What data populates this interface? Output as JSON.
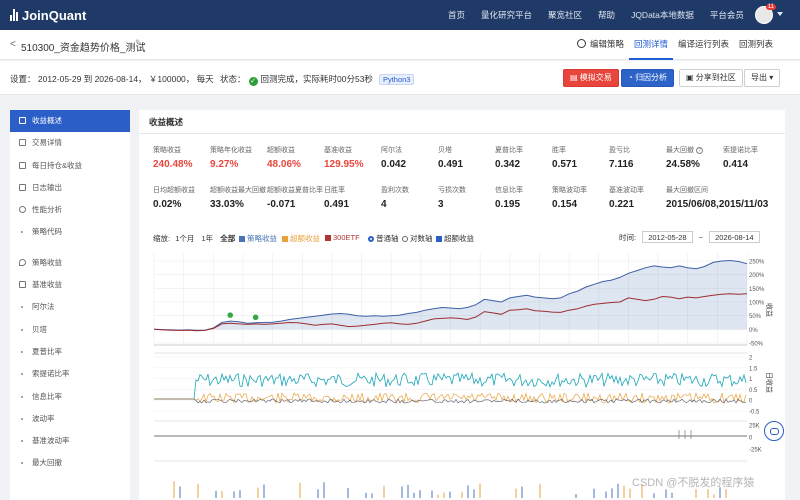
{
  "brand": {
    "name": "JoinQuant"
  },
  "nav": {
    "items": [
      "首页",
      "量化研究平台",
      "聚宽社区",
      "帮助",
      "JQData本地数据",
      "平台会员"
    ],
    "badge_count": "11"
  },
  "titlebar": {
    "back": "<",
    "title": "510300_资金趋势价格_测试",
    "tabs": [
      "编辑策略",
      "回测详情",
      "编译运行列表",
      "回测列表"
    ],
    "active_tab": "回测详情"
  },
  "settings": {
    "text": "设置： 2012-05-29 到 2026-08-14， ￥100000， 每天",
    "status_label": "状态：",
    "status_text": "回测完成，实际耗时00分53秒",
    "python": "Python3",
    "buttons": {
      "sim": "模拟交易",
      "attribution": "归因分析",
      "share": "分享到社区",
      "export": "导出"
    }
  },
  "sidebar": {
    "items": [
      "收益概述",
      "交易详情",
      "每日持仓&收益",
      "日志输出",
      "性能分析",
      "策略代码",
      "策略收益",
      "基准收益",
      "阿尔法",
      "贝塔",
      "夏普比率",
      "索提诺比率",
      "信息比率",
      "波动率",
      "基准波动率",
      "最大回撤"
    ]
  },
  "summary": {
    "title": "收益概述",
    "row1": [
      {
        "label": "策略收益",
        "value": "240.48%",
        "red": true
      },
      {
        "label": "策略年化收益",
        "value": "9.27%",
        "red": true
      },
      {
        "label": "超额收益",
        "value": "48.06%",
        "red": true
      },
      {
        "label": "基准收益",
        "value": "129.95%",
        "red": true
      },
      {
        "label": "阿尔法",
        "value": "0.042"
      },
      {
        "label": "贝塔",
        "value": "0.491"
      },
      {
        "label": "夏普比率",
        "value": "0.342"
      },
      {
        "label": "胜率",
        "value": "0.571"
      },
      {
        "label": "盈亏比",
        "value": "7.116"
      },
      {
        "label": "最大回撤",
        "value": "24.58%",
        "red": true
      },
      {
        "label": "索提诺比率",
        "value": "0.414"
      }
    ],
    "row2": [
      {
        "label": "日均超额收益",
        "value": "0.02%"
      },
      {
        "label": "超额收益最大回撤",
        "value": "33.03%"
      },
      {
        "label": "超额收益夏普比率",
        "value": "-0.071"
      },
      {
        "label": "日胜率",
        "value": "0.491"
      },
      {
        "label": "盈利次数",
        "value": "4"
      },
      {
        "label": "亏损次数",
        "value": "3"
      },
      {
        "label": "信息比率",
        "value": "0.195"
      },
      {
        "label": "策略波动率",
        "value": "0.154"
      },
      {
        "label": "基准波动率",
        "value": "0.221"
      },
      {
        "label": "最大回撤区间",
        "value": "2015/06/08,2015/11/03"
      }
    ]
  },
  "chart_controls": {
    "zoom_label": "缩放:",
    "zoom_options": [
      "1个月",
      "1年",
      "全部"
    ],
    "zoom_active": "全部",
    "legend": [
      {
        "name": "策略收益",
        "color": "#4a74b8"
      },
      {
        "name": "超额收益",
        "color": "#e8a23c"
      },
      {
        "name": "300ETF",
        "color": "#b03434"
      }
    ],
    "axis_normal": "普通轴",
    "axis_log": "对数轴",
    "excess": "超额收益",
    "time_label": "时间:",
    "date_from": "2012-05-28",
    "date_to": "2026-08-14"
  },
  "chart_data": {
    "type": "line",
    "y_ticks_main": [
      "250%",
      "200%",
      "150%",
      "100%",
      "50%",
      "0%",
      "-50%"
    ],
    "y_label_main": "收益",
    "ylim_main": [
      -50,
      250
    ],
    "y_ticks_mid": [
      "2",
      "1.5",
      "1",
      "0.5",
      "0",
      "-0.5"
    ],
    "y_label_mid": "日收益",
    "y_ticks_low": [
      "25K",
      "0",
      "-25K"
    ],
    "strategy": [
      0,
      -1,
      -2,
      -3,
      -2,
      -4,
      -3,
      5,
      25,
      30,
      28,
      22,
      24,
      25,
      26,
      30,
      36,
      40,
      44,
      48,
      52,
      56,
      58,
      55,
      50,
      48,
      50,
      48,
      50,
      52,
      58,
      62,
      70,
      75,
      80,
      78,
      75,
      80,
      90,
      110,
      105,
      100,
      115,
      120,
      125,
      118,
      115,
      112,
      115,
      130,
      140,
      155,
      165,
      175,
      180,
      190,
      205,
      215,
      225,
      232,
      228,
      225,
      232,
      225,
      222,
      230,
      245,
      250,
      252,
      248,
      240
    ],
    "benchmark": [
      0,
      -2,
      -3,
      -4,
      -3,
      -5,
      -4,
      3,
      20,
      22,
      20,
      18,
      20,
      18,
      20,
      22,
      25,
      24,
      20,
      15,
      18,
      20,
      15,
      10,
      12,
      15,
      18,
      22,
      24,
      20,
      18,
      22,
      30,
      38,
      40,
      42,
      40,
      36,
      45,
      65,
      60,
      55,
      70,
      72,
      75,
      68,
      66,
      63,
      62,
      70,
      75,
      85,
      92,
      95,
      98,
      100,
      115,
      110,
      105,
      110,
      120,
      118,
      112,
      118,
      115,
      120,
      125,
      128,
      130,
      128,
      130
    ],
    "date_range": [
      "2012-05-28",
      "2026-08-14"
    ]
  },
  "watermark": "CSDN @不脱发的程序猿"
}
